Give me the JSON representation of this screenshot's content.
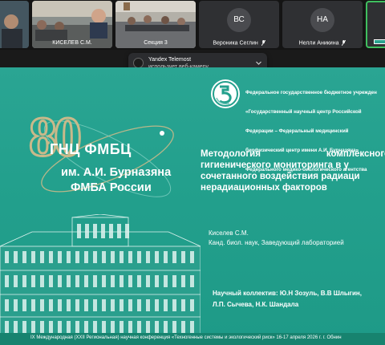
{
  "participants": [
    {
      "name": "",
      "type": "video"
    },
    {
      "name": "КИСЕЛЁВ С.М.",
      "type": "video",
      "muted": false
    },
    {
      "name": "Секция 3",
      "type": "video",
      "muted": false
    },
    {
      "name": "Вероника Сеглин",
      "type": "avatar",
      "initials": "ВС",
      "muted": true,
      "color": "#4a4b4f"
    },
    {
      "name": "Нелли Аникина",
      "type": "avatar",
      "initials": "НА",
      "muted": true,
      "color": "#4a4b4f"
    },
    {
      "name": "",
      "type": "avatar",
      "initials": "",
      "active": true
    }
  ],
  "toast": {
    "app": "Yandex Telemost",
    "message": "использует веб-камеру"
  },
  "slide": {
    "org_text": [
      "Федеральное государственное бюджетное учрежден",
      "«Государственный научный центр Российской",
      "Федерации – Федеральный медицинский",
      "биофизический центр имени А.И. Бурназяна»",
      "Федерального медико-биологического агентства"
    ],
    "anniversary": {
      "number": "80",
      "line1": "ГНЦ ФМБЦ",
      "line2": "им. А.И. Бурназяна",
      "line3": "ФМБА России"
    },
    "title_lines": [
      "Методология комплексного",
      "гигиенического мониторинга в у",
      "сочетанного воздействия радиаци",
      "нерадиационных факторов"
    ],
    "author_name": "Киселев С.М.",
    "author_position": "Канд. биол. наук, Заведующий лабораторией",
    "team_line1": "Научный коллектив: Ю.Н Зозуль, В.В Шлыгин,",
    "team_line2": "Л.П. Сычева, Н.К. Шандала",
    "footer": "IX Международная (XXII Региональная) научная конференция «Техногенные системы и экологический риск» 16-17 апреля 2026 г. г. Обнин",
    "colors": {
      "background": "#23a08d",
      "accent": "#c9b98a"
    }
  }
}
